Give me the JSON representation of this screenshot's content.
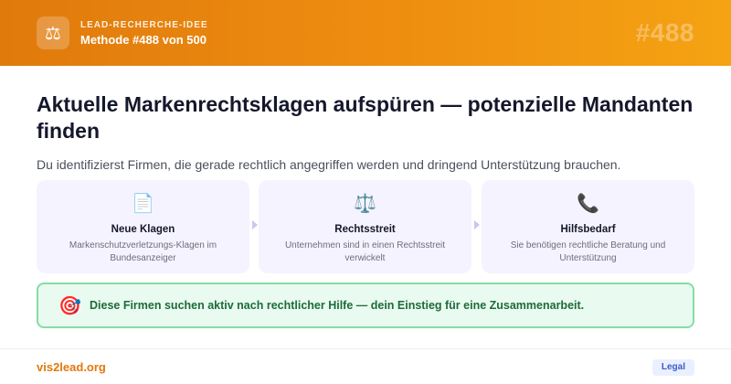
{
  "header": {
    "icon": "scales-icon",
    "eyebrow": "LEAD-RECHERCHE-IDEE",
    "method": "Methode #488 von 500",
    "number": "#488"
  },
  "main": {
    "title": "Aktuelle Markenrechtsklagen aufspüren — potenzielle Mandanten finden",
    "subtitle": "Du identifizierst Firmen, die gerade rechtlich angegriffen werden und dringend Unterstützung brauchen."
  },
  "steps": [
    {
      "icon": "document-icon",
      "glyph": "📄",
      "title": "Neue Klagen",
      "desc": "Markenschutzverletzungs-Klagen im Bundesanzeiger"
    },
    {
      "icon": "scales-icon",
      "glyph": "⚖️",
      "title": "Rechtsstreit",
      "desc": "Unternehmen sind in einen Rechtsstreit verwickelt"
    },
    {
      "icon": "phone-icon",
      "glyph": "📞",
      "title": "Hilfsbedarf",
      "desc": "Sie benötigen rechtliche Beratung und Unterstützung"
    }
  ],
  "callout": {
    "icon": "target-icon",
    "glyph": "🎯",
    "text": "Diese Firmen suchen aktiv nach rechtlicher Hilfe — dein Einstieg für eine Zusammenarbeit."
  },
  "footer": {
    "brand": "vis2lead.org",
    "badge": "Legal"
  },
  "colors": {
    "accent": "#e07a0c",
    "callout_green": "#1c6b3a",
    "badge_blue": "#3b5bcc"
  }
}
